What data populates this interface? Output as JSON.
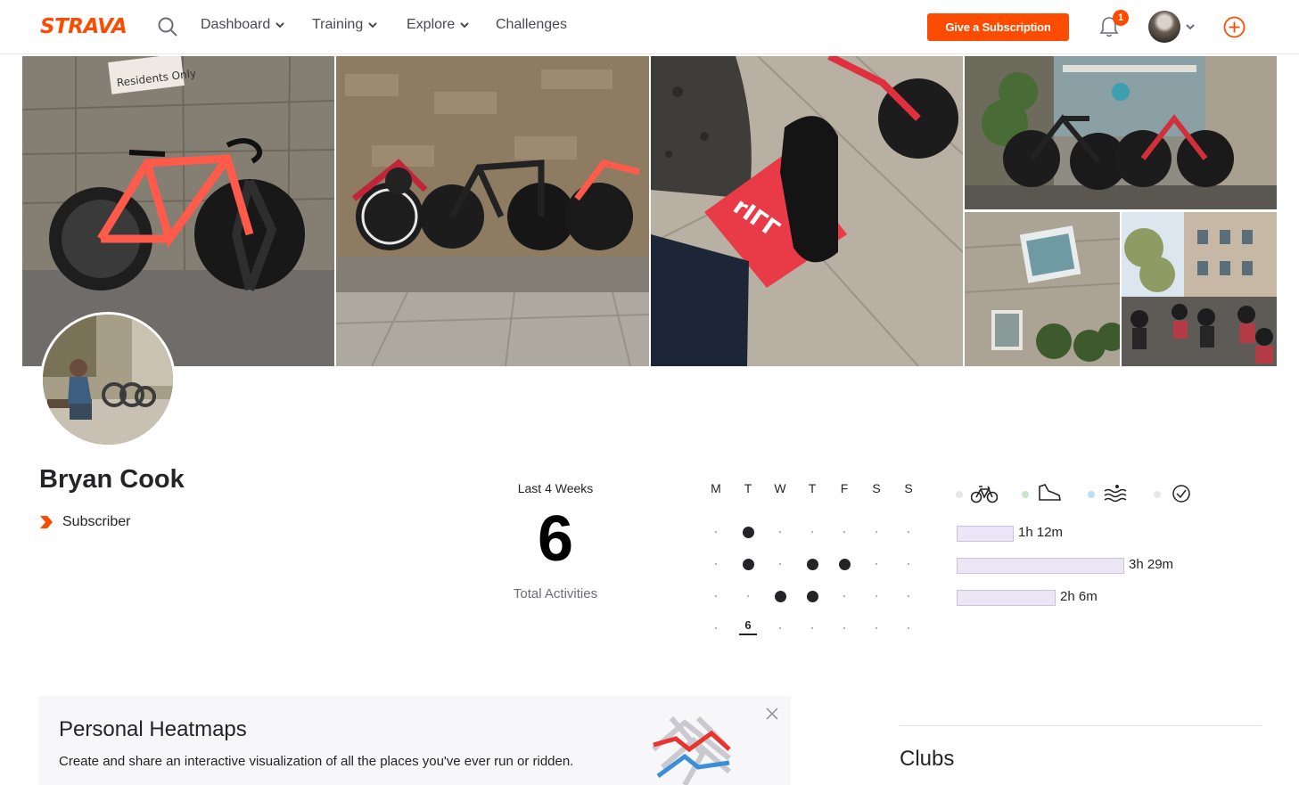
{
  "nav": {
    "logo": "STRAVA",
    "items": [
      {
        "label": "Dashboard",
        "has_menu": true
      },
      {
        "label": "Training",
        "has_menu": true
      },
      {
        "label": "Explore",
        "has_menu": true
      },
      {
        "label": "Challenges",
        "has_menu": false
      }
    ],
    "subscribe_button": "Give a Subscription",
    "notification_count": "1",
    "accent_color": "#fc4c02"
  },
  "photos": [
    {
      "alt_icon": "bike-photo"
    },
    {
      "alt_icon": "bikes-against-wall-photo"
    },
    {
      "alt_icon": "cycling-sock-photo"
    },
    {
      "alt_icon": "bikes-by-door-photo"
    },
    {
      "alt_icon": "pub-sign-photo"
    },
    {
      "alt_icon": "group-ride-photo"
    }
  ],
  "photo_signs": {
    "residents": "Residents Only",
    "sock": "rIΓΓ"
  },
  "athlete": {
    "name": "Bryan Cook",
    "badge": "Subscriber"
  },
  "stats": {
    "period_label": "Last 4 Weeks",
    "total": "6",
    "total_label": "Total Activities",
    "days": [
      "M",
      "T",
      "W",
      "T",
      "F",
      "S",
      "S"
    ],
    "weeks": [
      [
        0,
        1,
        0,
        0,
        0,
        0,
        0
      ],
      [
        0,
        1,
        0,
        1,
        1,
        0,
        0
      ],
      [
        0,
        0,
        1,
        1,
        0,
        0,
        0
      ],
      [
        0,
        0,
        0,
        0,
        0,
        0,
        0
      ]
    ],
    "current_week_count": "6",
    "sports": [
      {
        "icon": "bike-icon",
        "dot_color": "#e6e6eb"
      },
      {
        "icon": "run-shoe-icon",
        "dot_color": "#c8e6c9"
      },
      {
        "icon": "swim-icon",
        "dot_color": "#bbdefb"
      },
      {
        "icon": "other-activity-icon",
        "dot_color": "#e6e6eb"
      }
    ],
    "durations": [
      {
        "label": "1h 12m",
        "fraction": 0.34
      },
      {
        "label": "3h 29m",
        "fraction": 1.0
      },
      {
        "label": "2h 6m",
        "fraction": 0.59
      }
    ]
  },
  "heatmap_card": {
    "title": "Personal Heatmaps",
    "description": "Create and share an interactive visualization of all the places you've ever run or ridden."
  },
  "clubs": {
    "title": "Clubs"
  }
}
